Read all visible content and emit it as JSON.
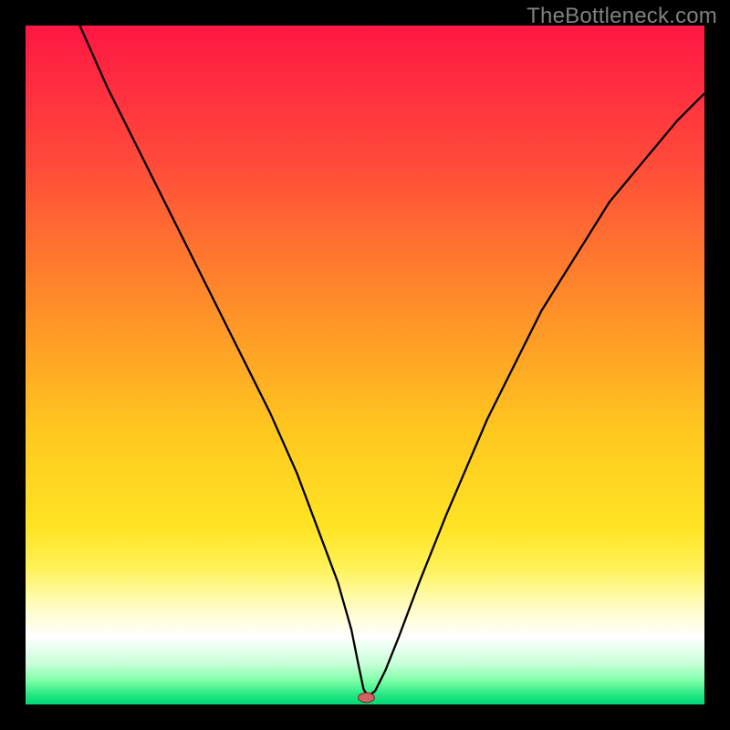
{
  "watermark": "TheBottleneck.com",
  "chart_data": {
    "type": "line",
    "title": "",
    "xlabel": "",
    "ylabel": "",
    "xlim": [
      0,
      100
    ],
    "ylim": [
      0,
      100
    ],
    "grid": false,
    "gradient_stops": [
      {
        "offset": 0.0,
        "color": "#ff1744"
      },
      {
        "offset": 0.2,
        "color": "#ff4a3a"
      },
      {
        "offset": 0.4,
        "color": "#ff8a2a"
      },
      {
        "offset": 0.6,
        "color": "#ffc81f"
      },
      {
        "offset": 0.74,
        "color": "#ffe424"
      },
      {
        "offset": 0.8,
        "color": "#fff25a"
      },
      {
        "offset": 0.85,
        "color": "#fffcb8"
      },
      {
        "offset": 0.9,
        "color": "#ffffff"
      },
      {
        "offset": 0.94,
        "color": "#c8ffd8"
      },
      {
        "offset": 0.965,
        "color": "#7effa8"
      },
      {
        "offset": 0.985,
        "color": "#26e884"
      },
      {
        "offset": 1.0,
        "color": "#00d874"
      }
    ],
    "series": [
      {
        "name": "bottleneck-curve",
        "stroke": "#000000",
        "stroke_width": 2.3,
        "x": [
          8,
          12,
          16,
          20,
          24,
          28,
          32,
          36,
          40,
          43,
          46,
          48,
          49,
          49.8,
          50.5,
          51.5,
          53,
          55,
          58,
          62,
          68,
          76,
          86,
          96,
          100
        ],
        "y": [
          100,
          91,
          83,
          75,
          67,
          59,
          51,
          43,
          34,
          26,
          18,
          11,
          6,
          2.2,
          1.2,
          2.0,
          5,
          10,
          18,
          28,
          42,
          58,
          74,
          86,
          90
        ]
      }
    ],
    "marker": {
      "name": "optimal-point",
      "x": 50.2,
      "y": 1.0,
      "rx": 1.2,
      "ry": 0.7,
      "fill": "#d06464",
      "stroke": "#7a2e2e"
    }
  }
}
